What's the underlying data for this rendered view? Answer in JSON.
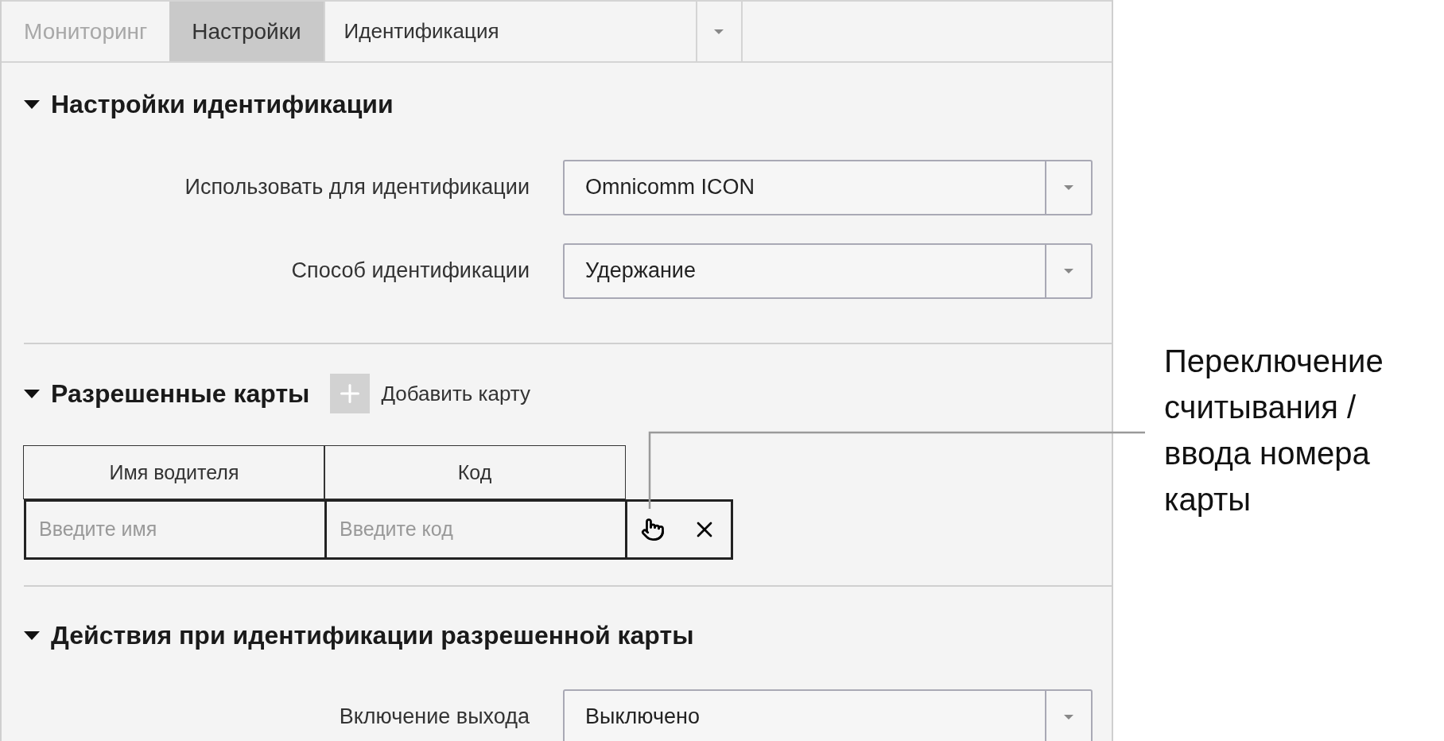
{
  "tabs": [
    {
      "label": "Мониторинг",
      "selected": false,
      "kind": "tab"
    },
    {
      "label": "Настройки",
      "selected": true,
      "kind": "tab"
    },
    {
      "label": "Идентификация",
      "selected": false,
      "kind": "dropdown"
    }
  ],
  "sections": [
    {
      "title": "Настройки идентификации",
      "expanded": true,
      "kind": "form",
      "fields": [
        {
          "label": "Использовать для идентификации",
          "value": "Omnicomm ICON"
        },
        {
          "label": "Способ идентификации",
          "value": "Удержание"
        }
      ]
    },
    {
      "title": "Разрешенные карты",
      "expanded": true,
      "kind": "cards",
      "add_label": "Добавить карту",
      "columns": [
        "Имя водителя",
        "Код"
      ],
      "rows": [
        {
          "name_placeholder": "Введите имя",
          "code_placeholder": "Введите код"
        }
      ]
    },
    {
      "title": "Действия при идентификации разрешенной карты",
      "expanded": true,
      "kind": "form",
      "fields": [
        {
          "label": "Включение выхода",
          "value": "Выключено"
        }
      ]
    }
  ],
  "callout": {
    "text": "Переключение\nсчитывания /\nввода номера\nкарты"
  }
}
